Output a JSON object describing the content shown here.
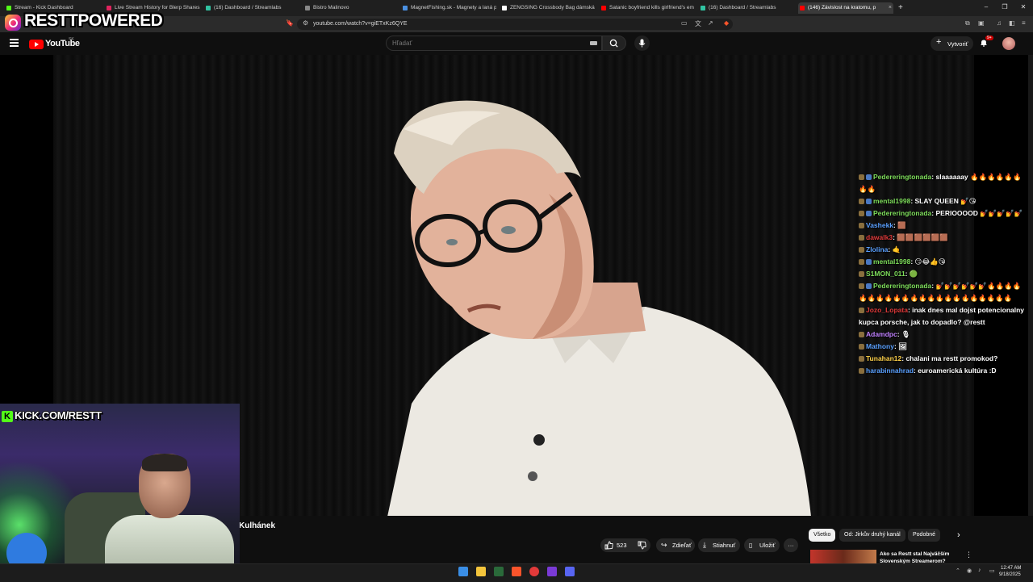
{
  "browser": {
    "tabs": [
      {
        "title": "Stream - Kick Dashboard",
        "color": "#53fc18"
      },
      {
        "title": "Live Stream History for Blerp Shares",
        "color": "#e0245e"
      },
      {
        "title": "(16) Dashboard / Streamlabs",
        "color": "#31c3a2"
      },
      {
        "title": "Bistro Malinovo",
        "color": "#888888"
      },
      {
        "title": "MagnetFishing.sk - Magnety a laná p",
        "color": "#4a90e2"
      },
      {
        "title": "ZENGSING Crossbody Bag dámská s",
        "color": "#ffffff"
      },
      {
        "title": "Satanic boyfriend kills girlfriend's em",
        "color": "#ff0000"
      },
      {
        "title": "(16) Dashboard / Streamlabs",
        "color": "#31c3a2"
      },
      {
        "title": "(146) Závislost na kratomu, p",
        "color": "#ff0000"
      }
    ],
    "tab_close": "×",
    "new_tab": "+",
    "win_controls": [
      "–",
      "❐",
      "✕"
    ],
    "url": "youtube.com/watch?v=giETxKz6QYE"
  },
  "overlay": {
    "brand": "RESTTPOWERED",
    "kick": "KICK.COM/RESTT",
    "kick_letter": "K"
  },
  "youtube": {
    "logo_text": "YouTube",
    "region": "SK",
    "search_placeholder": "Hľadať",
    "create_label": "Vytvoriť",
    "create_plus": "+",
    "bell_badge": "9+",
    "channel_name": "Kulhánek",
    "like_count": "523",
    "share_label": "Zdieľať",
    "download_label": "Stiahnuť",
    "save_label": "Uložiť",
    "more": "···",
    "filters": [
      "Všetko",
      "Od: Jirkův druhý kanál",
      "Podobné"
    ],
    "rec_title": "Ako sa Restt stal Najväčším Slovenským Streamerom?",
    "rec_more": "⋮",
    "chevron": "›"
  },
  "chat": [
    {
      "user": "Pedereringtonada",
      "text": "slaaaaaay 🔥🔥🔥🔥🔥🔥🔥🔥",
      "color": "#7ddc5a",
      "badge": 2
    },
    {
      "user": "mental1998",
      "text": "SLAY QUEEN 💅😘",
      "color": "#7ddc5a",
      "badge": 2
    },
    {
      "user": "Pedereringtonada",
      "text": "PERIOOOOD 💅💅💅💅💅",
      "color": "#7ddc5a",
      "badge": 2
    },
    {
      "user": "Vashekk",
      "text": "🟫",
      "color": "#5aa0ff",
      "badge": 1
    },
    {
      "user": "dawalk3",
      "text": "🟫🟫🟫🟫🟫🟫",
      "color": "#e03a3a",
      "badge": 1
    },
    {
      "user": "Zlolina",
      "text": "🤙",
      "color": "#5aa0ff",
      "badge": 1
    },
    {
      "user": "mental1998",
      "text": "😏😂👍😘",
      "color": "#7ddc5a",
      "badge": 2
    },
    {
      "user": "S1MON_011",
      "text": "🟢",
      "color": "#7ddc5a",
      "badge": 1
    },
    {
      "user": "Pedereringtonada",
      "text": "💅💅💅💅💅💅🔥🔥🔥🔥🔥🔥🔥🔥🔥🔥🔥🔥🔥🔥🔥🔥🔥🔥🔥🔥🔥🔥",
      "color": "#7ddc5a",
      "badge": 2
    },
    {
      "user": "Jozo_Lopata",
      "text": "inak dnes mal dojst potencionalny kupca porsche, jak to dopadlo? @restt",
      "color": "#e03a3a",
      "badge": 1
    },
    {
      "user": "Adamdpc",
      "text": "🎙",
      "color": "#c080ff",
      "badge": 1
    },
    {
      "user": "Mathony",
      "text": "🖼",
      "color": "#5aa0ff",
      "badge": 1
    },
    {
      "user": "Tunahan12",
      "text": "chalani ma restt promokod?",
      "color": "#ffd24a",
      "badge": 1
    },
    {
      "user": "harabinnahrad",
      "text": "euroamerická kultúra :D",
      "color": "#5aa0ff",
      "badge": 1
    }
  ],
  "taskbar": {
    "time": "12:47 AM",
    "date": "9/18/2025"
  }
}
